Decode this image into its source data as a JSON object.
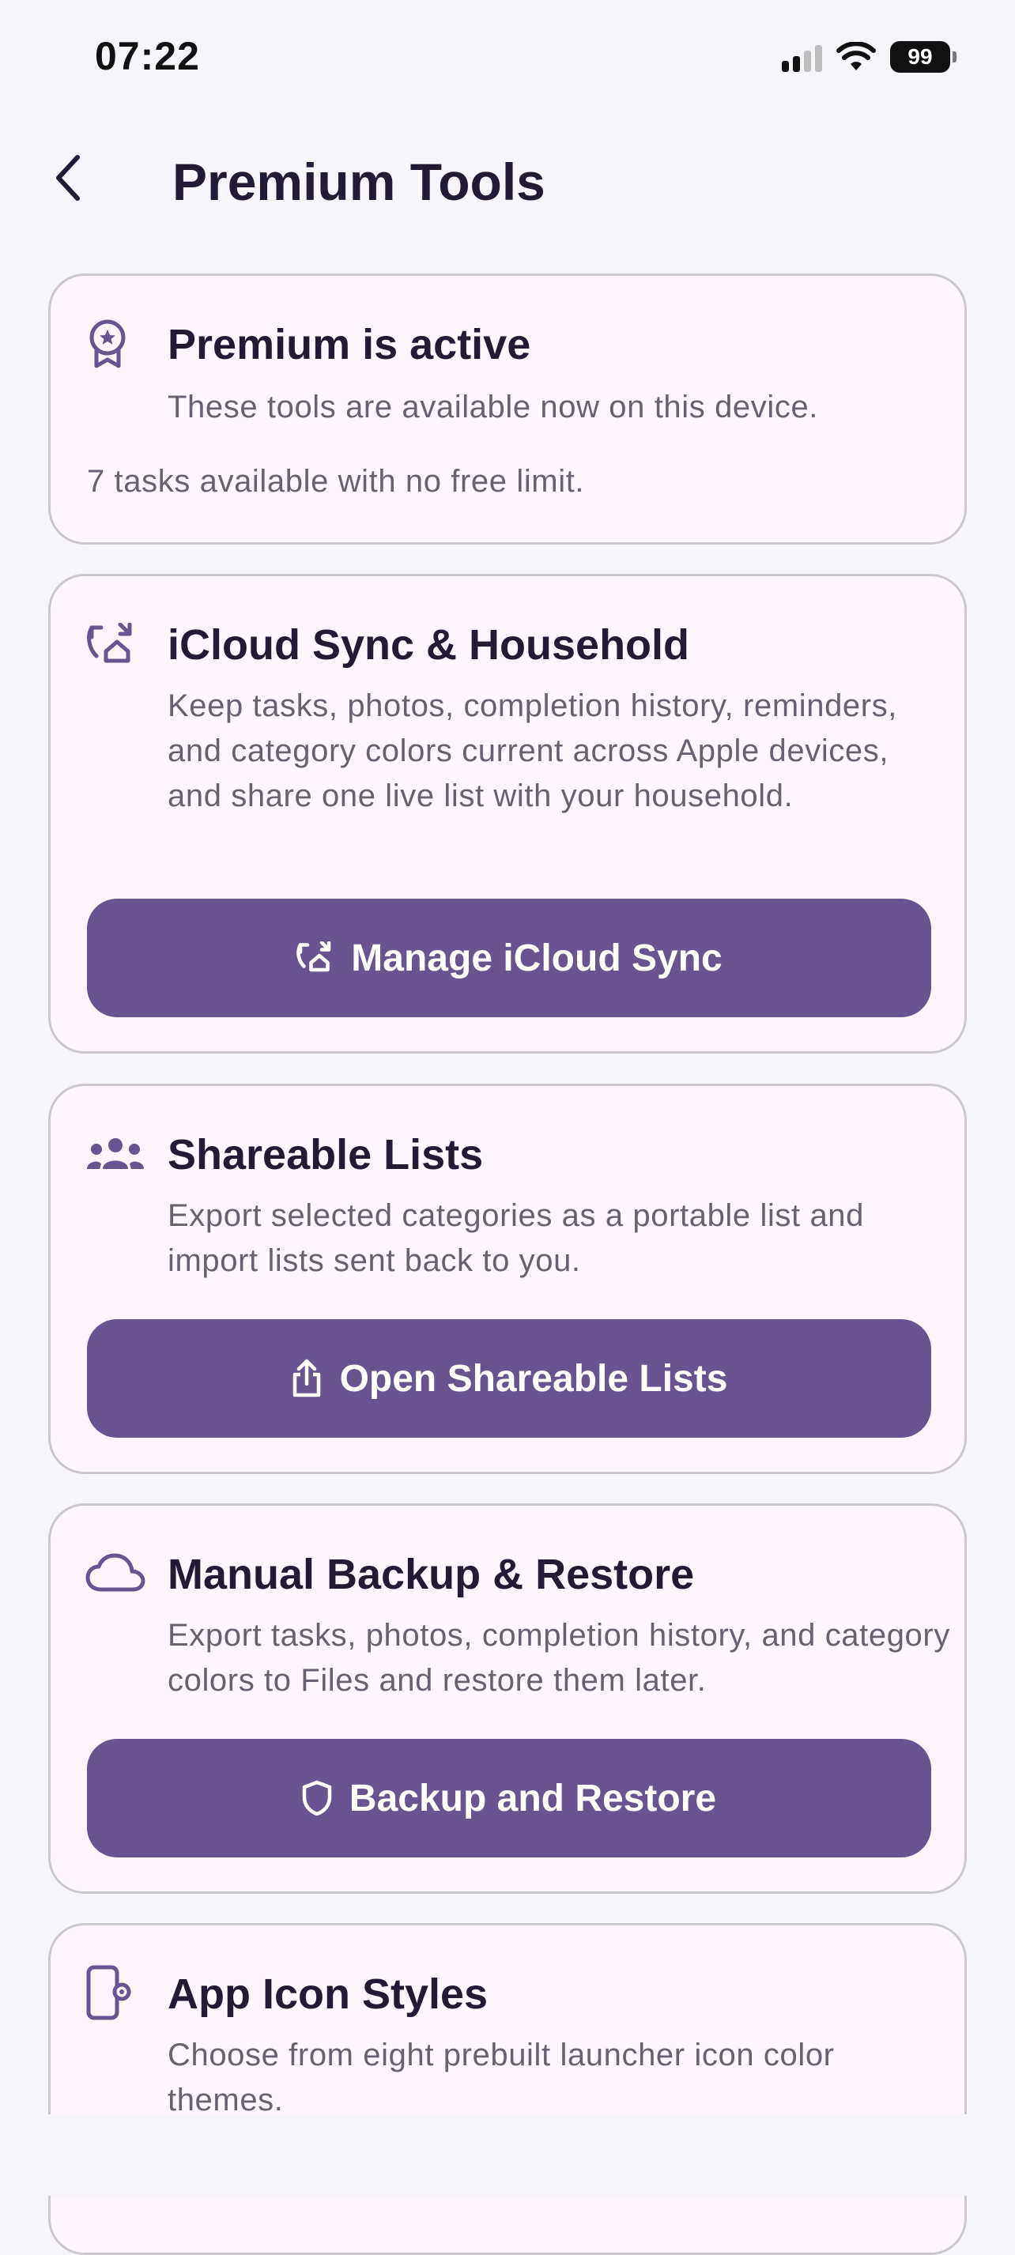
{
  "status_bar": {
    "time": "07:22",
    "battery": "99"
  },
  "nav": {
    "title": "Premium Tools"
  },
  "premium_card": {
    "icon": "award-badge-icon",
    "title": "Premium is active",
    "subtitle": "These tools are available now on this device.",
    "note": "7 tasks available with no free limit."
  },
  "icloud_card": {
    "icon": "sync-household-icon",
    "title": "iCloud Sync & Household",
    "description": "Keep tasks, photos, completion history, reminders, and category colors current across Apple devices, and share one live list with your household.",
    "button_label": "Manage iCloud Sync"
  },
  "share_card": {
    "icon": "group-icon",
    "title": "Shareable Lists",
    "description": "Export selected categories as a portable list and import lists sent back to you.",
    "button_label": "Open Shareable Lists"
  },
  "backup_card": {
    "icon": "cloud-icon",
    "title": "Manual Backup & Restore",
    "description": "Export tasks, photos, completion history, and category colors to Files and restore them later.",
    "button_label": "Backup and Restore"
  },
  "icon_card": {
    "icon": "phone-settings-icon",
    "title": "App Icon Styles",
    "description": "Choose from eight prebuilt launcher icon color themes."
  },
  "colors": {
    "accent": "#68548e",
    "card_bg": "#fdf7fd",
    "page_bg": "#f6f5fa"
  }
}
